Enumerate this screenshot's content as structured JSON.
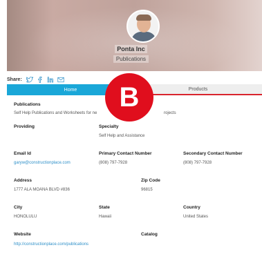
{
  "profile": {
    "company_name": "Ponta Inc",
    "category": "Publications"
  },
  "share": {
    "label": "Share:",
    "icons": [
      "twitter-icon",
      "facebook-icon",
      "linkedin-icon",
      "email-icon"
    ]
  },
  "tabs": [
    {
      "label": "Home",
      "active": true
    },
    {
      "label": "Products",
      "active": false
    }
  ],
  "badge": {
    "letter": "B"
  },
  "details": {
    "publications_label": "Publications",
    "publications_text": "Self Help Publications and Worksheets for ne",
    "publications_text_right": "rojects",
    "providing_label": "Providing",
    "speciality_label": "Specialty",
    "speciality_value": "Self Help and Assistance",
    "email_label": "Email Id",
    "email_value": "garyw@constructionplace.com",
    "primary_contact_label": "Primary Contact Number",
    "primary_contact_value": "(808) 797-7928",
    "secondary_contact_label": "Secondary Contact Number",
    "secondary_contact_value": "(808) 797-7928",
    "address_label": "Address",
    "address_value": "1777 ALA MOANA BLVD #836",
    "zip_label": "Zip Code",
    "zip_value": "96815",
    "city_label": "City",
    "city_value": "HONOLULU",
    "state_label": "State",
    "state_value": "Hawaii",
    "country_label": "Country",
    "country_value": "United States",
    "website_label": "Website",
    "website_value": "http://constructionplace.com/publications",
    "catalog_label": "Catalog"
  },
  "colors": {
    "tab_active": "#1aa7d8",
    "badge": "#e00e1d",
    "link": "#2d8fc8"
  }
}
